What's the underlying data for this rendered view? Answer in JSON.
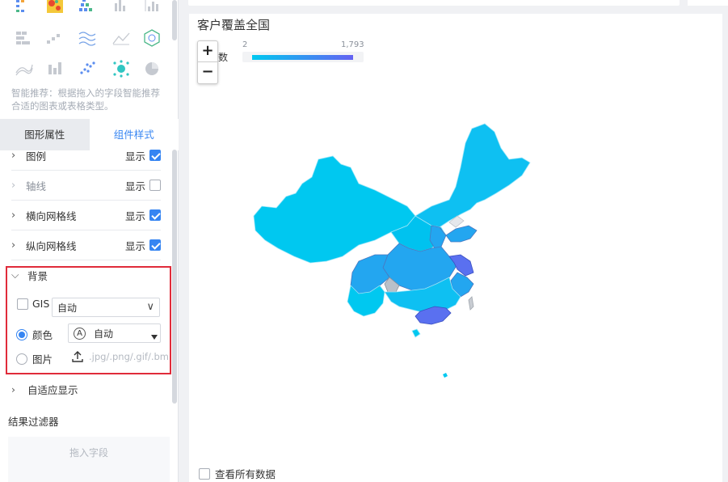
{
  "left_panel": {
    "hint": "智能推荐：根据拖入的字段智能推荐合适的图表或表格类型。",
    "tabs": [
      {
        "label": "图形属性",
        "active": false
      },
      {
        "label": "组件样式",
        "active": true
      }
    ],
    "props": [
      {
        "label": "图例",
        "show_label": "显示",
        "checked": true,
        "enabled": true
      },
      {
        "label": "轴线",
        "show_label": "显示",
        "checked": false,
        "enabled": false
      },
      {
        "label": "横向网格线",
        "show_label": "显示",
        "checked": true,
        "enabled": true
      },
      {
        "label": "纵向网格线",
        "show_label": "显示",
        "checked": true,
        "enabled": true
      }
    ],
    "background": {
      "title": "背景",
      "gis_label": "GIS",
      "gis_checked": false,
      "gis_value": "自动",
      "color_label": "颜色",
      "color_value": "自动",
      "color_icon": "A",
      "image_label": "图片",
      "upload_hint": ".jpg/.png/.gif/.bm"
    },
    "adaptive": "自适应显示",
    "filter_title": "结果过滤器",
    "drop_hint": "拖入字段"
  },
  "chart": {
    "title": "客户覆盖全国",
    "legend_label": "数",
    "legend_min": "2",
    "legend_max": "1,793",
    "show_all_label": "查看所有数据",
    "zoom_in": "+",
    "zoom_out": "−"
  },
  "colors": {
    "accent": "#3685f2",
    "red_box": "#e02b3a",
    "map_light": "#00c8f0",
    "map_mid": "#23a6f0",
    "map_dark": "#6462f2"
  }
}
